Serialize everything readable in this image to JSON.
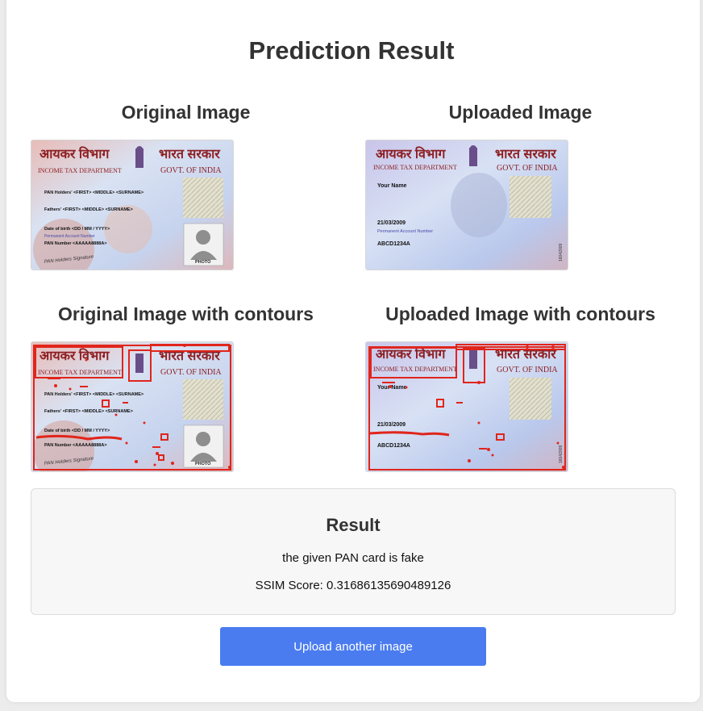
{
  "page": {
    "title": "Prediction Result"
  },
  "images": {
    "original_title": "Original Image",
    "uploaded_title": "Uploaded Image",
    "original_contours_title": "Original Image with contours",
    "uploaded_contours_title": "Uploaded Image with contours"
  },
  "card_text": {
    "hindi_left": "आयकर विभाग",
    "hindi_right": "भारत सरकार",
    "dept": "INCOME TAX DEPARTMENT",
    "govt": "GOVT. OF INDIA",
    "orig_name": "PAN Holders' <FIRST> <MIDDLE> <SURNAME>",
    "orig_father": "Fathers' <FIRST> <MIDDLE> <SURNAME>",
    "orig_dob": "Date of birth <DD / MM / YYYY>",
    "pan_label": "Permanent Account Number",
    "orig_pan": "PAN Number <AAAAA8888A>",
    "signature": "PAN Holders Signature",
    "photo": "PHOTO",
    "up_name": "Your Name",
    "up_dob": "21/03/2009",
    "up_pan": "ABCD1234A",
    "up_side": "16042009"
  },
  "result": {
    "title": "Result",
    "message": "the given PAN card is fake",
    "ssim": "SSIM Score: 0.31686135690489126"
  },
  "actions": {
    "upload_label": "Upload another image"
  },
  "colors": {
    "accent": "#4a7cf0",
    "contour": "#e0251b"
  }
}
